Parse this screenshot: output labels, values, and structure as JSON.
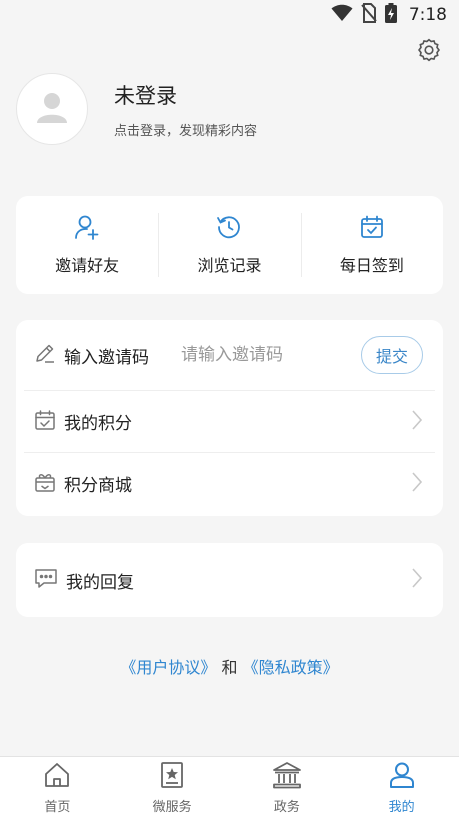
{
  "status_bar": {
    "time": "7:18",
    "icons": [
      "wifi-icon",
      "no-sim-icon",
      "battery-charging-icon"
    ]
  },
  "profile": {
    "name": "未登录",
    "subtitle": "点击登录，发现精彩内容"
  },
  "quick_actions": [
    {
      "label": "邀请好友",
      "icon": "add-user-icon"
    },
    {
      "label": "浏览记录",
      "icon": "history-icon"
    },
    {
      "label": "每日签到",
      "icon": "calendar-check-icon"
    }
  ],
  "invite": {
    "label": "输入邀请码",
    "placeholder": "请输入邀请码",
    "value": "",
    "submit_label": "提交"
  },
  "list": {
    "points_label": "我的积分",
    "mall_label": "积分商城",
    "reply_label": "我的回复"
  },
  "links": {
    "user_agreement": "《用户协议》",
    "and": "和",
    "privacy_policy": "《隐私政策》"
  },
  "tabs": [
    {
      "label": "首页",
      "icon": "home-icon",
      "active": false
    },
    {
      "label": "微服务",
      "icon": "star-bookmark-icon",
      "active": false
    },
    {
      "label": "政务",
      "icon": "government-building-icon",
      "active": false
    },
    {
      "label": "我的",
      "icon": "user-icon",
      "active": true
    }
  ],
  "colors": {
    "accent": "#2f86d0",
    "background": "#f5f5f5",
    "card": "#ffffff"
  }
}
